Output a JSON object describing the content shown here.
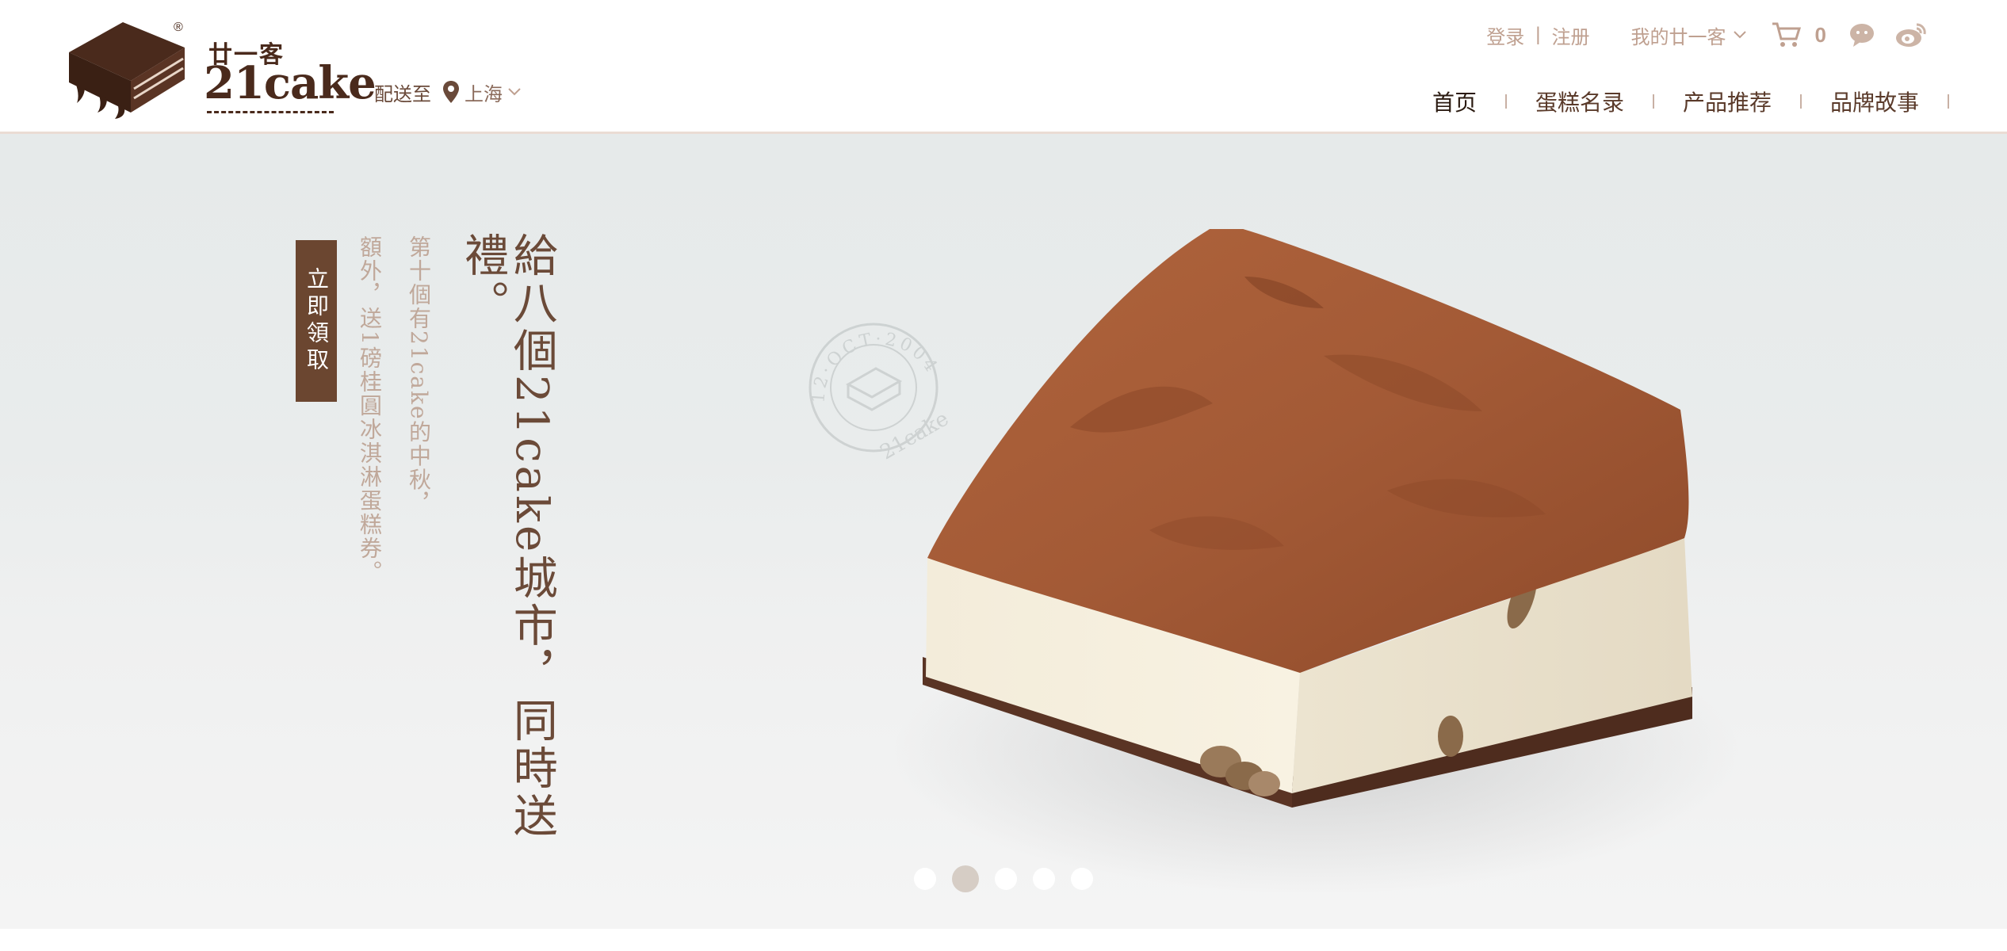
{
  "brand": {
    "name_cn": "廿一客",
    "name_en": "21cake",
    "registered": "®"
  },
  "delivery": {
    "label": "配送至",
    "city": "上海"
  },
  "top_links": {
    "login": "登录",
    "separator": "|",
    "register": "注册",
    "my_account": "我的廿一客",
    "cart_count": "0"
  },
  "nav": {
    "items": [
      "首页",
      "蛋糕名录",
      "产品推荐",
      "品牌故事"
    ],
    "active_index": 0
  },
  "banner": {
    "headline": "給八個21cake城市，同時送禮。",
    "subline_1": "第十個有21cake的中秋，",
    "subline_2": "額外，送1磅桂圓冰淇淋蛋糕券。",
    "cta": "立即領取",
    "stamp_text": "12·OCT·2004",
    "stamp_brand": "21cake",
    "slides": 5,
    "active_slide": 2
  },
  "colors": {
    "brand_brown": "#6b4630",
    "link_muted": "#bfa090",
    "cocoa": "#a35a36"
  }
}
